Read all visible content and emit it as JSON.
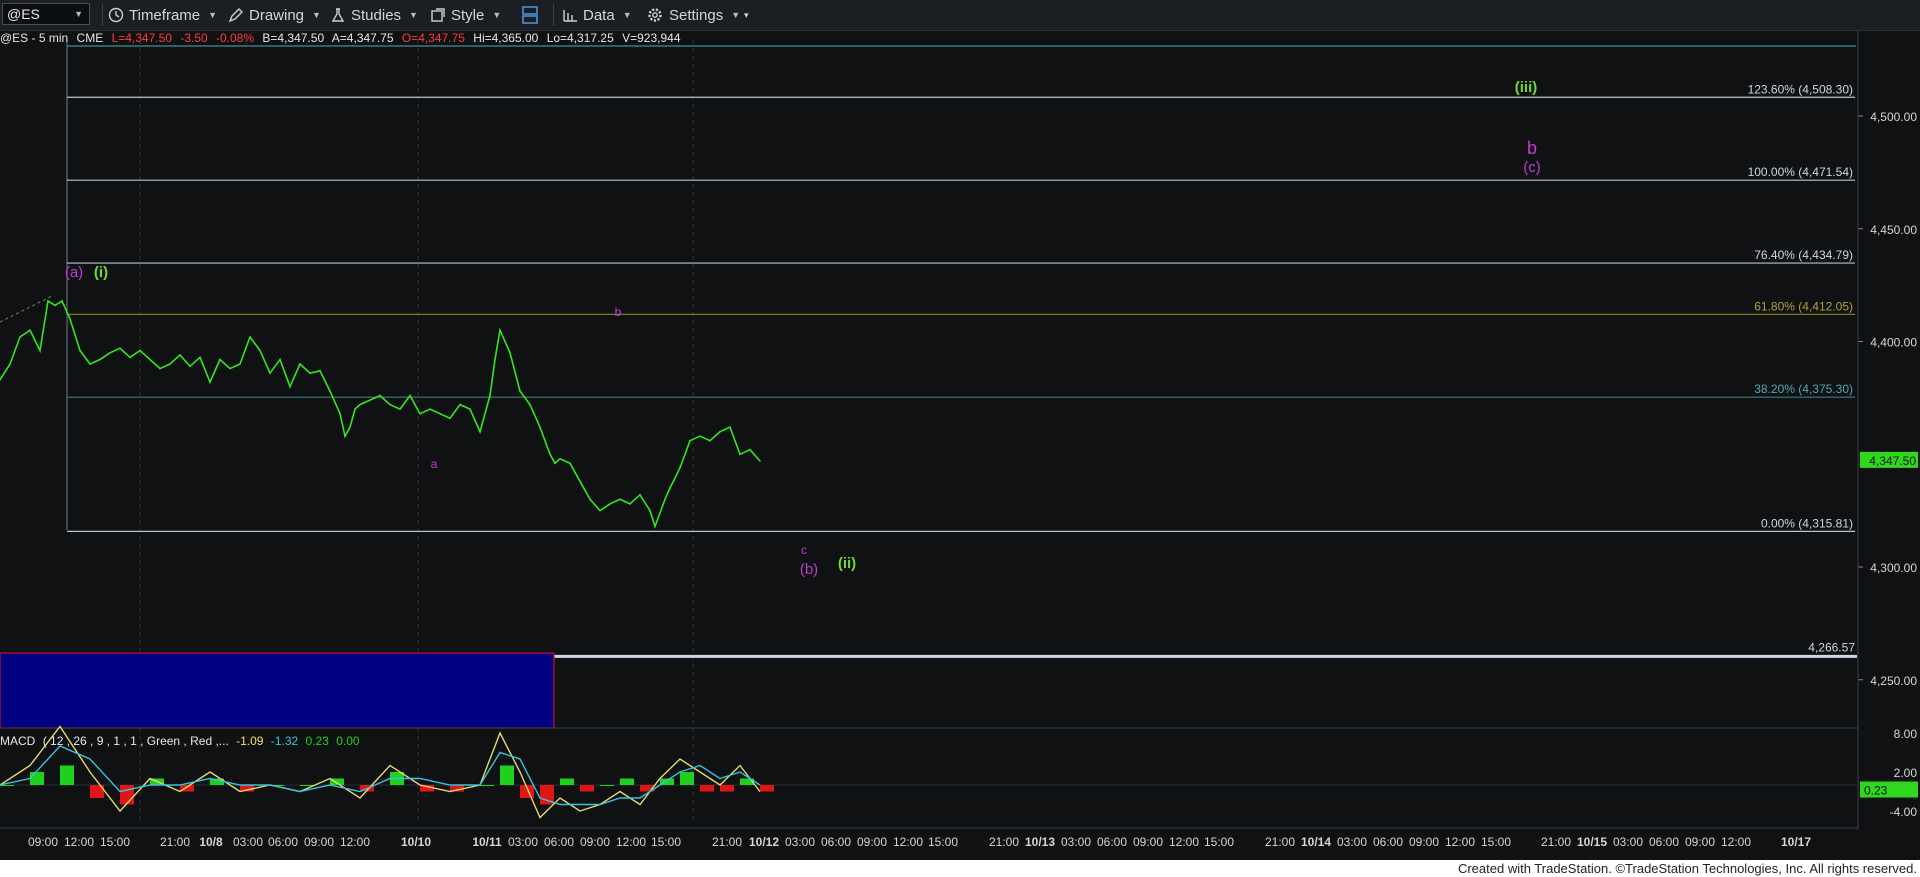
{
  "toolbar": {
    "symbol": "@ES",
    "timeframe": "Timeframe",
    "drawing": "Drawing",
    "studies": "Studies",
    "style": "Style",
    "data": "Data",
    "settings": "Settings"
  },
  "infobar": {
    "symbol": "@ES - 5 min",
    "exchange": "CME",
    "last": "L=4,347.50",
    "change": "-3.50",
    "pct": "-0.08%",
    "bid": "B=4,347.50",
    "ask": "A=4,347.75",
    "open": "O=4,347.75",
    "high": "Hi=4,365.00",
    "low": "Lo=4,317.25",
    "volume": "V=923,944"
  },
  "colors": {
    "background": "#0f1113",
    "price": "#33e61f",
    "wave_magenta": "#c43bd6",
    "wave_green": "#6edc32",
    "fib_line": "#9fb0c4",
    "fib_618": "#8a8a2e",
    "fib_382": "#3c7a80",
    "blue_box": "#000080",
    "macd": "#e8d96a",
    "signal": "#36c4e0",
    "hist_pos": "#1fd11f",
    "hist_neg": "#e01616"
  },
  "chart_data": [
    {
      "type": "line",
      "series": [
        {
          "x": [
            0,
            10,
            20,
            30,
            40,
            48,
            55,
            62,
            70,
            80,
            90,
            100,
            110,
            120,
            130,
            140,
            150,
            160,
            170,
            180,
            190,
            200,
            210,
            220,
            230,
            240,
            250,
            260,
            270,
            280,
            290,
            300,
            310,
            320,
            330,
            340,
            345,
            350,
            355,
            360,
            370,
            380,
            390,
            400,
            410,
            420,
            430,
            440,
            450,
            460,
            470,
            480,
            490,
            495,
            500,
            505,
            510,
            520,
            530,
            540,
            550,
            555,
            560,
            570,
            580,
            590,
            600,
            610,
            620,
            630,
            640,
            650,
            655,
            660,
            665,
            670,
            680,
            690,
            700,
            710,
            720,
            730,
            740,
            750,
            760
          ],
          "y": [
            4383,
            4390,
            4402,
            4405,
            4396,
            4418,
            4416,
            4418,
            4410,
            4396,
            4390,
            4392,
            4395,
            4397,
            4393,
            4396,
            4392,
            4388,
            4390,
            4394,
            4389,
            4393,
            4382,
            4392,
            4388,
            4390,
            4402,
            4396,
            4386,
            4392,
            4380,
            4390,
            4386,
            4387,
            4378,
            4368,
            4358,
            4362,
            4370,
            4372,
            4374,
            4376,
            4372,
            4370,
            4376,
            4368,
            4370,
            4368,
            4366,
            4372,
            4370,
            4360,
            4376,
            4392,
            4405,
            4400,
            4395,
            4378,
            4372,
            4362,
            4350,
            4346,
            4348,
            4346,
            4338,
            4330,
            4325,
            4328,
            4330,
            4328,
            4332,
            4325,
            4318,
            4324,
            4330,
            4335,
            4344,
            4356,
            4358,
            4356,
            4360,
            4362,
            4350,
            4352,
            4347
          ]
        }
      ],
      "yaxis_labels": [
        "4,500.00",
        "4,450.00",
        "4,400.00",
        "4,300.00",
        "4,250.00"
      ],
      "last_price": "4,347.50",
      "xaxis_labels": [
        "09:00",
        "12:00",
        "15:00",
        "21:00",
        "10/8",
        "03:00",
        "06:00",
        "09:00",
        "12:00",
        "10/10",
        "10/11",
        "03:00",
        "06:00",
        "09:00",
        "12:00",
        "15:00",
        "21:00",
        "10/12",
        "03:00",
        "06:00",
        "09:00",
        "12:00",
        "15:00",
        "21:00",
        "10/13",
        "03:00",
        "06:00",
        "09:00",
        "12:00",
        "15:00",
        "21:00",
        "10/14",
        "03:00",
        "06:00",
        "09:00",
        "12:00",
        "15:00",
        "21:00",
        "10/15",
        "03:00",
        "06:00",
        "09:00",
        "12:00",
        "10/17"
      ],
      "fib_levels": [
        {
          "label": "123.60% (4,508.30)",
          "price": 4508.3
        },
        {
          "label": "100.00% (4,471.54)",
          "price": 4471.54
        },
        {
          "label": "76.40% (4,434.79)",
          "price": 4434.79
        },
        {
          "label": "61.80% (4,412.05)",
          "price": 4412.05
        },
        {
          "label": "38.20% (4,375.30)",
          "price": 4375.3
        },
        {
          "label": "0.00% (4,315.81)",
          "price": 4315.81
        }
      ],
      "support_line": {
        "label": "4,266.57",
        "price": 4266.57
      },
      "wave_labels": [
        {
          "text": "(a)",
          "color": "magenta"
        },
        {
          "text": "(i)",
          "color": "green"
        },
        {
          "text": "a",
          "color": "magenta"
        },
        {
          "text": "b",
          "color": "magenta"
        },
        {
          "text": "c",
          "color": "magenta"
        },
        {
          "text": "(b)",
          "color": "magenta"
        },
        {
          "text": "(ii)",
          "color": "green"
        },
        {
          "text": "(iii)",
          "color": "green"
        },
        {
          "text": "b",
          "color": "magenta"
        },
        {
          "text": "(c)",
          "color": "magenta"
        }
      ]
    },
    {
      "type": "line",
      "title": "MACD",
      "params": "( 12 , 26 , 9 , 1 , 1 , Green , Red ,...",
      "values": [
        "-1.09",
        "-1.32",
        "0.23",
        "0.00"
      ],
      "yaxis_labels": [
        "8.00",
        "2.00",
        "-4.00"
      ],
      "last_value": "0.23",
      "series": [
        {
          "name": "MACD",
          "x": [
            0,
            30,
            60,
            90,
            120,
            150,
            180,
            210,
            240,
            270,
            300,
            330,
            360,
            390,
            420,
            450,
            480,
            500,
            520,
            540,
            560,
            580,
            600,
            620,
            640,
            660,
            680,
            700,
            720,
            740,
            760
          ],
          "y": [
            0,
            3,
            9,
            2,
            -4,
            1,
            -1,
            2,
            -1,
            0,
            -1,
            1,
            -2,
            3,
            0,
            -1,
            0,
            8,
            2,
            -5,
            -2,
            -4,
            -3,
            -1,
            -3,
            1,
            4,
            2,
            0,
            3,
            -1
          ]
        },
        {
          "name": "Signal",
          "x": [
            0,
            30,
            60,
            90,
            120,
            150,
            180,
            210,
            240,
            270,
            300,
            330,
            360,
            390,
            420,
            450,
            480,
            500,
            520,
            540,
            560,
            580,
            600,
            620,
            640,
            660,
            680,
            700,
            720,
            740,
            760
          ],
          "y": [
            0,
            1,
            6,
            4,
            -1,
            0,
            0,
            1,
            0,
            0,
            -1,
            0,
            -1,
            1,
            1,
            0,
            0,
            5,
            4,
            -2,
            -3,
            -3,
            -3,
            -2,
            -2,
            0,
            2,
            3,
            1,
            2,
            0
          ]
        },
        {
          "name": "Histogram",
          "x": [
            0,
            30,
            60,
            90,
            120,
            150,
            180,
            210,
            240,
            270,
            300,
            330,
            360,
            390,
            420,
            450,
            480,
            500,
            520,
            540,
            560,
            580,
            600,
            620,
            640,
            660,
            680,
            700,
            720,
            740,
            760
          ],
          "y": [
            0,
            2,
            3,
            -2,
            -3,
            1,
            -1,
            1,
            -1,
            0,
            0,
            1,
            -1,
            2,
            -1,
            -1,
            0,
            3,
            -2,
            -3,
            1,
            -1,
            0,
            1,
            -1,
            1,
            2,
            -1,
            -1,
            1,
            -1
          ]
        }
      ]
    }
  ],
  "footer": "Created with TradeStation. ©TradeStation Technologies, Inc. All rights reserved."
}
